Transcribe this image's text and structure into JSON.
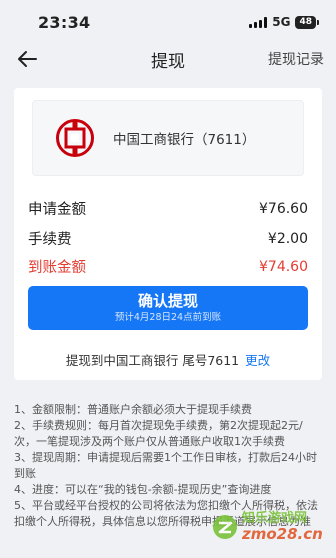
{
  "status_bar": {
    "time": "23:34",
    "network": "5G",
    "battery": "48"
  },
  "header": {
    "title": "提现",
    "right_link": "提现记录",
    "back_icon": "arrow-left-icon"
  },
  "bank": {
    "icon": "icbc-logo-icon",
    "name": "中国工商银行（7611）",
    "brand_color": "#c7000b"
  },
  "amounts": {
    "apply_label": "申请金额",
    "apply_value": "¥76.60",
    "fee_label": "手续费",
    "fee_value": "¥2.00",
    "received_label": "到账金额",
    "received_value": "¥74.60",
    "received_color": "#e53c32"
  },
  "confirm": {
    "label": "确认提现",
    "sub": "预计4月28日24点前到账",
    "color": "#1677f6"
  },
  "withdraw_target": {
    "text": "提现到中国工商银行 尾号7611",
    "change_label": "更改"
  },
  "rules": [
    "1、金额限制：普通账户余额必须大于提现手续费",
    "2、手续费规则：每月首次提现免手续费，第2次提现起2元/次，一笔提现涉及两个账户仅从普通账户收取1次手续费",
    "3、提现周期：申请提现后需要1个工作日审核，打款后24小时到账",
    "4、进度：可以在“我的钱包-余额-提现历史”查询进度",
    "5、平台或经平台授权的公司将依法为您扣缴个人所得税，依法扣缴个人所得税，具体信息以您所得税申报渠道展示信息为准"
  ],
  "watermark": {
    "top": "知乐游戏网",
    "bottom": "zmo28.cn"
  }
}
